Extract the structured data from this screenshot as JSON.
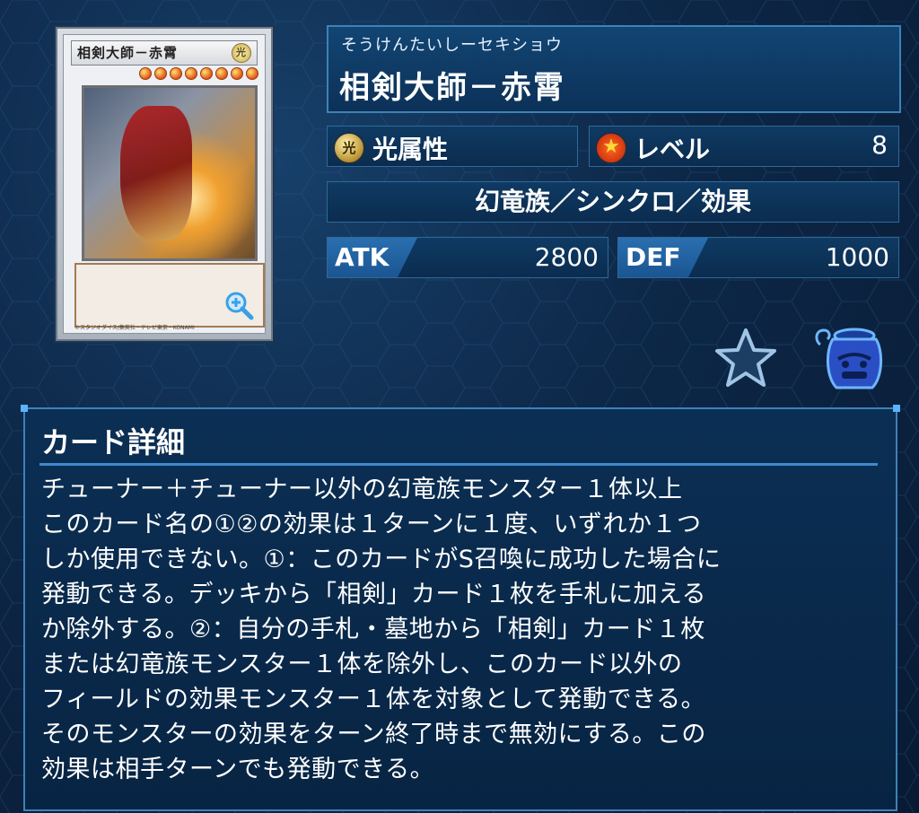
{
  "card": {
    "thumb_name": "相剣大師－赤霄",
    "thumb_attribute_glyph": "光",
    "level_stars": 8,
    "copyright": "©スタジオダイス/集英社・テレビ東京・KONAMI"
  },
  "name_panel": {
    "ruby": "そうけんたいしーセキショウ",
    "name": "相剣大師－赤霄"
  },
  "attribute": {
    "icon_glyph": "光",
    "label": "光属性"
  },
  "level": {
    "label": "レベル",
    "value": "8"
  },
  "type_line": "幻竜族／シンクロ／効果",
  "stats": {
    "atk_label": "ATK",
    "atk_value": "2800",
    "def_label": "DEF",
    "def_value": "1000"
  },
  "icons": {
    "zoom": "zoom-in-icon",
    "favorite": "star-icon",
    "jar": "pot-of-greed-icon"
  },
  "detail": {
    "title": "カード詳細",
    "text": "チューナー＋チューナー以外の幻竜族モンスター１体以上\nこのカード名の①②の効果は１ターンに１度、いずれか１つ\nしか使用できない。①：このカードがS召喚に成功した場合に\n発動できる。デッキから「相剣」カード１枚を手札に加える\nか除外する。②：自分の手札・墓地から「相剣」カード１枚\nまたは幻竜族モンスター１体を除外し、このカード以外の\nフィールドの効果モンスター１体を対象として発動できる。\nそのモンスターの効果をターン終了時まで無効にする。この\n効果は相手ターンでも発動できる。"
  },
  "colors": {
    "panel_border": "#3c82b8",
    "accent_blue": "#2a6fb0",
    "background": "#0d2747"
  }
}
